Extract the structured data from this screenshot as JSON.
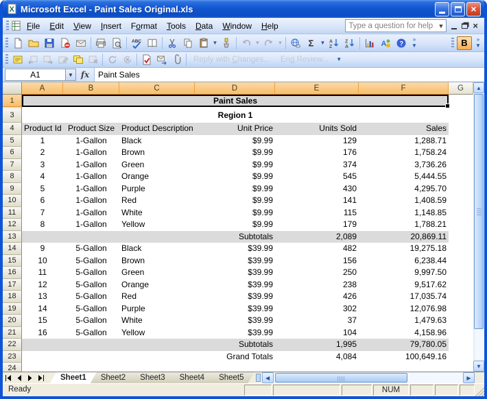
{
  "window": {
    "title": "Microsoft Excel - Paint Sales Original.xls"
  },
  "menu": {
    "items": [
      {
        "label": "File",
        "u": 0
      },
      {
        "label": "Edit",
        "u": 0
      },
      {
        "label": "View",
        "u": 0
      },
      {
        "label": "Insert",
        "u": 0
      },
      {
        "label": "Format",
        "u": 1
      },
      {
        "label": "Tools",
        "u": 0
      },
      {
        "label": "Data",
        "u": 0
      },
      {
        "label": "Window",
        "u": 0
      },
      {
        "label": "Help",
        "u": 0
      }
    ],
    "question_placeholder": "Type a question for help"
  },
  "toolbars": {
    "standard": [
      "new",
      "open",
      "save",
      "permission",
      "mail-recipient",
      "print",
      "print-preview",
      "spelling",
      "research",
      "cut",
      "copy",
      "paste",
      "format-painter",
      "undo",
      "redo",
      "insert-hyperlink",
      "autosum",
      "sort-ascending",
      "sort-descending",
      "chart-wizard",
      "drawing",
      "help"
    ],
    "formatting": {
      "bold_label": "B"
    },
    "reviewing": {
      "buttons": [
        "new-comment",
        "previous-comment",
        "next-comment",
        "edit-comment",
        "show-all-comments",
        "delete-comment",
        "accept-change",
        "reject-change",
        "update-file",
        "send-to-mail-recipient",
        "attach-file"
      ],
      "reply_label": "Reply with Changes...",
      "reply_accel_index": 11,
      "end_review_label": "End Review...",
      "end_review_accel_index": 2
    }
  },
  "formula_bar": {
    "name_box": "A1",
    "formula": "Paint Sales"
  },
  "sheet": {
    "column_headers": [
      "A",
      "B",
      "C",
      "D",
      "E",
      "F",
      "G"
    ],
    "row1": {
      "n": "1",
      "title": "Paint Sales"
    },
    "row3": {
      "n": "3",
      "label": "Region 1"
    },
    "header_row": {
      "n": "4",
      "cells": [
        "Product Id",
        "Product Size",
        "Product Description",
        "Unit Price",
        "Units Sold",
        "Sales"
      ]
    },
    "rows": [
      {
        "n": "5",
        "kind": "data",
        "id": "1",
        "size": "1-Gallon",
        "desc": "Black",
        "price": "$9.99",
        "units": "129",
        "sales": "1,288.71"
      },
      {
        "n": "6",
        "kind": "data",
        "id": "2",
        "size": "1-Gallon",
        "desc": "Brown",
        "price": "$9.99",
        "units": "176",
        "sales": "1,758.24"
      },
      {
        "n": "7",
        "kind": "data",
        "id": "3",
        "size": "1-Gallon",
        "desc": "Green",
        "price": "$9.99",
        "units": "374",
        "sales": "3,736.26"
      },
      {
        "n": "8",
        "kind": "data",
        "id": "4",
        "size": "1-Gallon",
        "desc": "Orange",
        "price": "$9.99",
        "units": "545",
        "sales": "5,444.55"
      },
      {
        "n": "9",
        "kind": "data",
        "id": "5",
        "size": "1-Gallon",
        "desc": "Purple",
        "price": "$9.99",
        "units": "430",
        "sales": "4,295.70"
      },
      {
        "n": "10",
        "kind": "data",
        "id": "6",
        "size": "1-Gallon",
        "desc": "Red",
        "price": "$9.99",
        "units": "141",
        "sales": "1,408.59"
      },
      {
        "n": "11",
        "kind": "data",
        "id": "7",
        "size": "1-Gallon",
        "desc": "White",
        "price": "$9.99",
        "units": "115",
        "sales": "1,148.85"
      },
      {
        "n": "12",
        "kind": "data",
        "id": "8",
        "size": "1-Gallon",
        "desc": "Yellow",
        "price": "$9.99",
        "units": "179",
        "sales": "1,788.21"
      },
      {
        "n": "13",
        "kind": "subtotal",
        "label": "Subtotals",
        "units": "2,089",
        "sales": "20,869.11"
      },
      {
        "n": "14",
        "kind": "data",
        "id": "9",
        "size": "5-Gallon",
        "desc": "Black",
        "price": "$39.99",
        "units": "482",
        "sales": "19,275.18"
      },
      {
        "n": "15",
        "kind": "data",
        "id": "10",
        "size": "5-Gallon",
        "desc": "Brown",
        "price": "$39.99",
        "units": "156",
        "sales": "6,238.44"
      },
      {
        "n": "16",
        "kind": "data",
        "id": "11",
        "size": "5-Gallon",
        "desc": "Green",
        "price": "$39.99",
        "units": "250",
        "sales": "9,997.50"
      },
      {
        "n": "17",
        "kind": "data",
        "id": "12",
        "size": "5-Gallon",
        "desc": "Orange",
        "price": "$39.99",
        "units": "238",
        "sales": "9,517.62"
      },
      {
        "n": "18",
        "kind": "data",
        "id": "13",
        "size": "5-Gallon",
        "desc": "Red",
        "price": "$39.99",
        "units": "426",
        "sales": "17,035.74"
      },
      {
        "n": "19",
        "kind": "data",
        "id": "14",
        "size": "5-Gallon",
        "desc": "Purple",
        "price": "$39.99",
        "units": "302",
        "sales": "12,076.98"
      },
      {
        "n": "20",
        "kind": "data",
        "id": "15",
        "size": "5-Gallon",
        "desc": "White",
        "price": "$39.99",
        "units": "37",
        "sales": "1,479.63"
      },
      {
        "n": "21",
        "kind": "data",
        "id": "16",
        "size": "5-Gallon",
        "desc": "Yellow",
        "price": "$39.99",
        "units": "104",
        "sales": "4,158.96"
      },
      {
        "n": "22",
        "kind": "subtotal",
        "label": "Subtotals",
        "units": "1,995",
        "sales": "79,780.05"
      },
      {
        "n": "23",
        "kind": "grand",
        "label": "Grand Totals",
        "units": "4,084",
        "sales": "100,649.16"
      },
      {
        "n": "24",
        "kind": "empty"
      }
    ]
  },
  "sheet_tabs": {
    "tabs": [
      "Sheet1",
      "Sheet2",
      "Sheet3",
      "Sheet4",
      "Sheet5"
    ],
    "active": "Sheet1"
  },
  "status_bar": {
    "mode": "Ready",
    "num_lock": "NUM"
  }
}
